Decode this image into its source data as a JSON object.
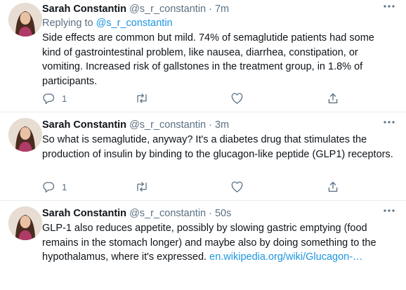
{
  "tweets": [
    {
      "author": "Sarah Constantin",
      "handle_time": "@s_r_constantin · 7m",
      "replying_prefix": "Replying to",
      "replying_mention": "@s_r_constantin",
      "text": "Side effects are common but mild. 74% of semaglutide patients had some kind of gastrointestinal problem, like nausea, diarrhea, constipation, or vomiting.  Increased risk of gallstones in the treatment group, in 1.8% of participants.",
      "reply_count": "1"
    },
    {
      "author": "Sarah Constantin",
      "handle_time": "@s_r_constantin · 3m",
      "text": "So what is semaglutide, anyway?  It's a diabetes drug that stimulates the production of insulin by binding to the glucagon-like peptide (GLP1) receptors.",
      "reply_count": "1"
    },
    {
      "author": "Sarah Constantin",
      "handle_time": "@s_r_constantin · 50s",
      "text": "GLP-1 also reduces appetite, possibly by slowing gastric emptying (food remains in the stomach longer) and maybe also by doing something to the hypothalamus, where it's expressed. ",
      "link_text": "en.wikipedia.org/wiki/Glucagon-…"
    }
  ],
  "icons": {
    "avatar": "avatar-photo",
    "more": "more-icon",
    "reply": "reply-icon",
    "retweet": "retweet-icon",
    "like": "like-icon",
    "share": "share-icon"
  },
  "colors": {
    "link": "#1b95e0",
    "secondary_text": "#5b7083",
    "divider": "#e6ecf0"
  }
}
